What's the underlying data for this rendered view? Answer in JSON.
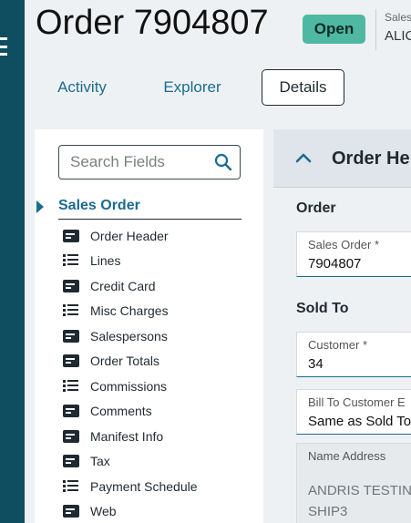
{
  "header": {
    "title": "Order 7904807",
    "status": "Open",
    "meta_label": "Sales",
    "meta_value": "ALIC"
  },
  "tabs": [
    {
      "label": "Activity"
    },
    {
      "label": "Explorer"
    },
    {
      "label": "Details",
      "selected": true
    }
  ],
  "fields_panel": {
    "search_placeholder": "Search Fields",
    "root_label": "Sales Order",
    "items": [
      {
        "label": "Order Header",
        "icon": "form-icon"
      },
      {
        "label": "Lines",
        "icon": "list-icon"
      },
      {
        "label": "Credit Card",
        "icon": "form-icon"
      },
      {
        "label": "Misc Charges",
        "icon": "list-icon"
      },
      {
        "label": "Salespersons",
        "icon": "form-icon"
      },
      {
        "label": "Order Totals",
        "icon": "form-icon"
      },
      {
        "label": "Commissions",
        "icon": "list-icon"
      },
      {
        "label": "Comments",
        "icon": "form-icon"
      },
      {
        "label": "Manifest Info",
        "icon": "form-icon"
      },
      {
        "label": "Tax",
        "icon": "form-icon"
      },
      {
        "label": "Payment Schedule",
        "icon": "list-icon"
      },
      {
        "label": "Web",
        "icon": "form-icon"
      }
    ]
  },
  "detail": {
    "section_title": "Order He",
    "order_group": "Order",
    "sales_order_label": "Sales Order *",
    "sales_order_value": "7904807",
    "sold_to_group": "Sold To",
    "customer_label": "Customer *",
    "customer_value": "34",
    "bill_to_label": "Bill To Customer E",
    "bill_to_value": "Same as Sold To",
    "name_address_label": "Name Address",
    "name_address_line1": "ANDRIS TESTIN",
    "name_address_line2": "SHIP3"
  },
  "colors": {
    "rail": "#0e4e60",
    "accent": "#1a6c8f",
    "status_badge": "#4fb8a2"
  }
}
